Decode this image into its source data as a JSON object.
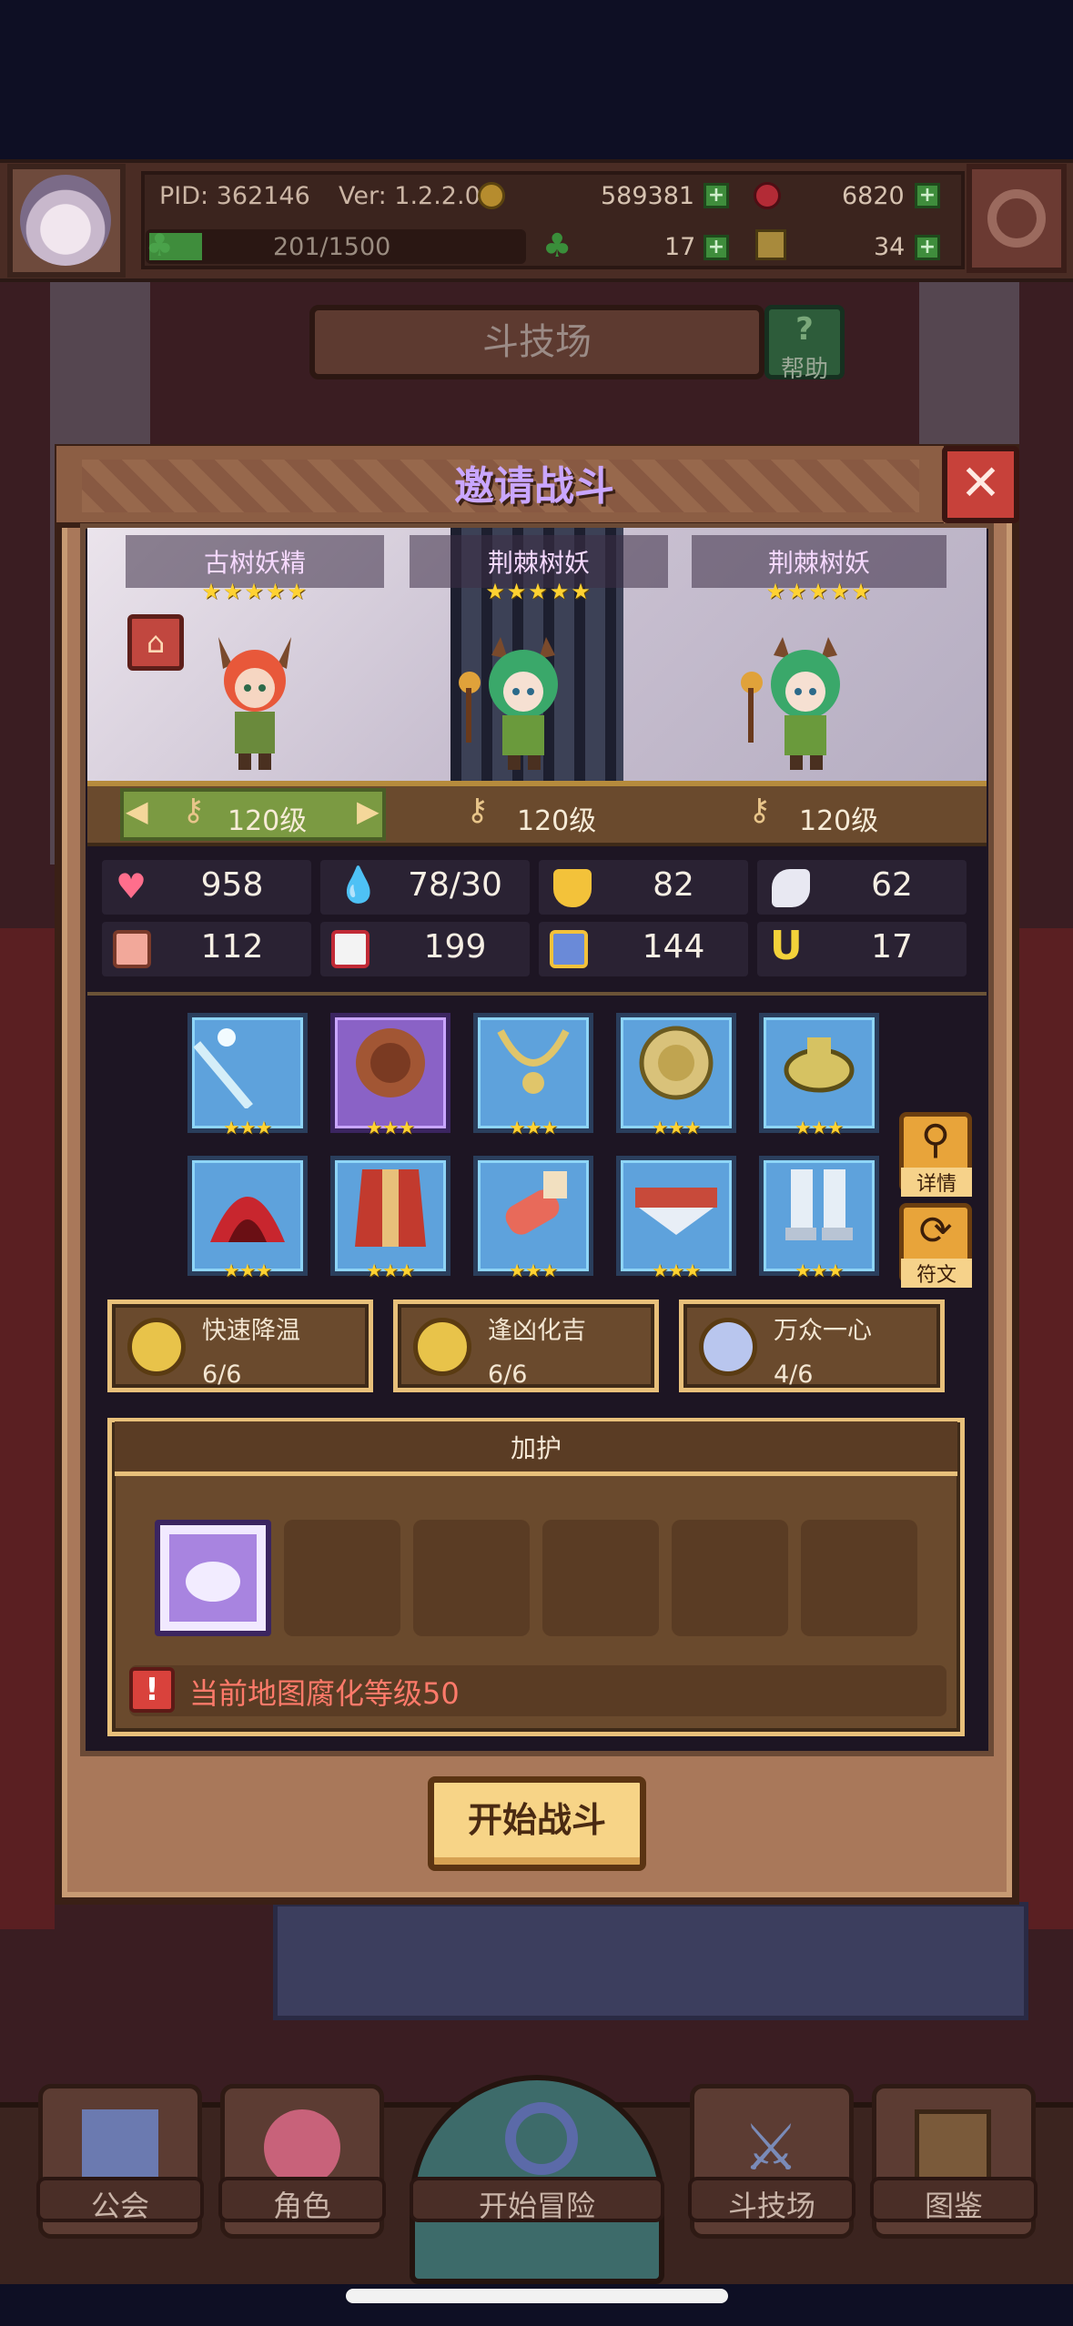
{
  "status": {
    "pid": "PID: 362146",
    "version": "Ver: 1.2.2.0",
    "gold": "589381",
    "gems": "6820",
    "energy": "201/1500",
    "clover": "17",
    "keys": "34"
  },
  "arena": {
    "title": "斗技场",
    "help_label": "帮助"
  },
  "dialog": {
    "title": "邀请战斗",
    "close_glyph": "✕",
    "heroes": [
      {
        "name": "古树妖精",
        "stars": "★★★★★",
        "level": "120级"
      },
      {
        "name": "荆棘树妖",
        "stars": "★★★★★",
        "level": "120级"
      },
      {
        "name": "荆棘树妖",
        "stars": "★★★★★",
        "level": "120级"
      }
    ],
    "stats": [
      {
        "icon": "heart-icon",
        "value": "958"
      },
      {
        "icon": "mana-drop-icon",
        "value": "78/30"
      },
      {
        "icon": "shield-icon",
        "value": "82"
      },
      {
        "icon": "wing-icon",
        "value": "62"
      },
      {
        "icon": "fist-icon",
        "value": "112"
      },
      {
        "icon": "spellbook-icon",
        "value": "199"
      },
      {
        "icon": "magic-scroll-icon",
        "value": "144"
      },
      {
        "icon": "horseshoe-icon",
        "value": "17"
      }
    ],
    "equipment_row1": [
      {
        "icon": "wand-icon",
        "rarity": "blue",
        "stars": "★★★"
      },
      {
        "icon": "rune-disc-icon",
        "rarity": "purple",
        "stars": "★★★"
      },
      {
        "icon": "necklace-icon",
        "rarity": "blue",
        "stars": "★★★"
      },
      {
        "icon": "coin-medal-icon",
        "rarity": "blue",
        "stars": "★★★"
      },
      {
        "icon": "ring-icon",
        "rarity": "blue",
        "stars": "★★★"
      }
    ],
    "equipment_row2": [
      {
        "icon": "hood-icon",
        "rarity": "blue",
        "stars": "★★★"
      },
      {
        "icon": "robe-icon",
        "rarity": "blue",
        "stars": "★★★"
      },
      {
        "icon": "glove-icon",
        "rarity": "blue",
        "stars": "★★★"
      },
      {
        "icon": "belt-icon",
        "rarity": "blue",
        "stars": "★★★"
      },
      {
        "icon": "boots-icon",
        "rarity": "blue",
        "stars": "★★★"
      }
    ],
    "side_buttons": {
      "details": "详情",
      "runes": "符文"
    },
    "skills": [
      {
        "name": "快速降温",
        "count": "6/6",
        "color": "#e8c34a"
      },
      {
        "name": "逢凶化吉",
        "count": "6/6",
        "color": "#e8c34a"
      },
      {
        "name": "万众一心",
        "count": "4/6",
        "color": "#b9c6ee"
      }
    ],
    "buff": {
      "title": "加护",
      "warning": "当前地图腐化等级50"
    },
    "start_button": "开始战斗"
  },
  "nav": {
    "items": [
      "公会",
      "角色",
      "开始冒险",
      "斗技场",
      "图鉴"
    ]
  },
  "colors": {
    "accent_purple": "#c9a6ff",
    "gold_star": "#ffd232",
    "warning_red": "#ff7a6a"
  }
}
